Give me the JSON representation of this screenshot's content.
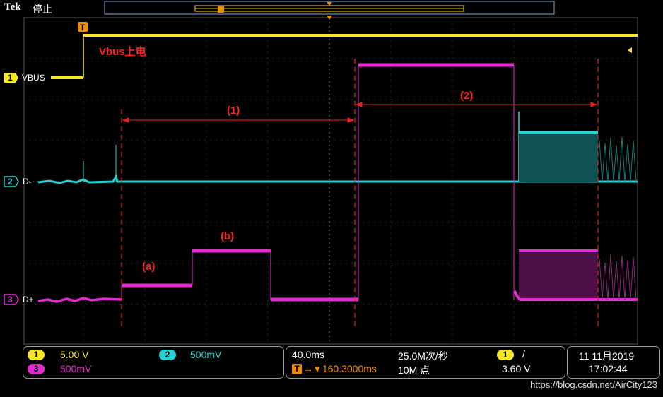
{
  "header": {
    "brand": "Tek",
    "run_state": "停止"
  },
  "channels": {
    "ch1": {
      "marker": "1",
      "name": "VBUS",
      "color": "#f5e62a"
    },
    "ch2": {
      "marker": "2",
      "name": "D-",
      "color": "#22d3d3"
    },
    "ch3": {
      "marker": "3",
      "name": "D+",
      "color": "#e62ad2"
    }
  },
  "trigger_marker": "T",
  "annotations": {
    "vbus_on": "Vbus上电",
    "interval_1": "(1)",
    "interval_2": "(2)",
    "state_a": "(a)",
    "state_b": "(b)"
  },
  "status": {
    "ch1_scale": "5.00 V",
    "ch2_scale": "500mV",
    "ch3_scale": "500mV",
    "time_per_div": "40.0ms",
    "sample_rate": "25.0M次/秒",
    "trigger_position": "▼160.3000ms",
    "record_length": "10M 点",
    "trigger_channel": "1",
    "trigger_slope": "/",
    "trigger_level": "3.60 V",
    "date": "11 11月2019",
    "time": "17:02:44"
  },
  "watermark": "https://blog.csdn.net/AirCity123"
}
